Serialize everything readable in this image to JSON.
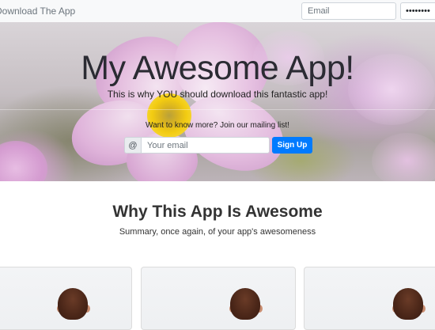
{
  "navbar": {
    "brand": "Download The App",
    "email_placeholder": "Email",
    "password_value": "••••••••"
  },
  "hero": {
    "title": "My Awesome App!",
    "subtitle": "This is why YOU should download this fantastic app!",
    "cta": "Want to know more? Join our mailing list!",
    "addon": "@",
    "email_placeholder": "Your email",
    "signup_label": "Sign Up"
  },
  "features": {
    "title": "Why This App Is Awesome",
    "subtitle": "Summary, once again, of your app's awesomeness"
  },
  "cards": [
    {
      "image": "person-photo"
    },
    {
      "image": "person-photo"
    },
    {
      "image": "person-photo"
    }
  ],
  "colors": {
    "primary": "#007bff",
    "navbar_bg": "#f8f9fa"
  }
}
